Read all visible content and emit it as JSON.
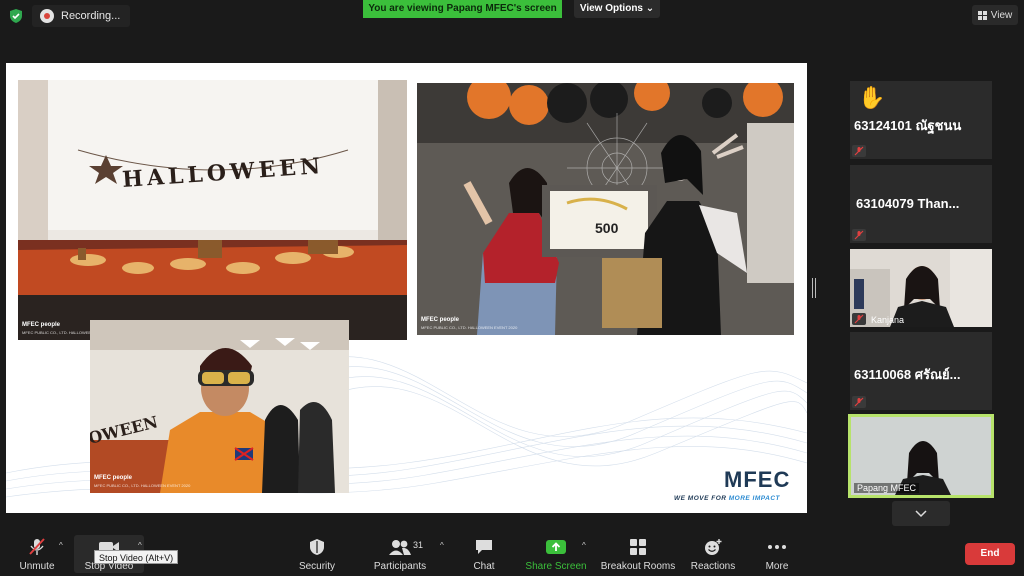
{
  "topbar": {
    "recording_label": "Recording...",
    "viewing_banner": "You are viewing Papang MFEC's screen",
    "view_options_label": "View Options",
    "view_button_label": "View"
  },
  "slide": {
    "banner_text": "HALLOWEEN",
    "photo_tag_brand": "MFEC people",
    "photo_tag_sub": "MFEC PUBLIC CO., LTD. HALLOWEEN EVENT 2020",
    "sign_text": "500",
    "logo": "MFEC",
    "slogan_prefix": "WE MOVE FOR ",
    "slogan_accent": "MORE IMPACT"
  },
  "participants": [
    {
      "name": "63124101 ณัฐชนน",
      "hand_raised": true,
      "muted": true
    },
    {
      "name": "63104079  Than...",
      "muted": true
    },
    {
      "name": "Kanjana",
      "video": true,
      "muted": true
    },
    {
      "name": "63110068 ศรัณย์...",
      "muted": true
    },
    {
      "name": "Papang MFEC",
      "video": true,
      "active_speaker": true
    }
  ],
  "toolbar": {
    "unmute": "Unmute",
    "stop_video": "Stop Video",
    "stop_video_tooltip": "Stop Video (Alt+V)",
    "security": "Security",
    "participants": "Participants",
    "participants_count": "31",
    "chat": "Chat",
    "share_screen": "Share Screen",
    "breakout_rooms": "Breakout Rooms",
    "reactions": "Reactions",
    "more": "More",
    "end": "End"
  },
  "colors": {
    "banner_green": "#3bbf3b",
    "share_green": "#3bbf3b",
    "end_red": "#d93a3a",
    "active_border": "#b7e36b",
    "brand_blue": "#1f3a56"
  }
}
